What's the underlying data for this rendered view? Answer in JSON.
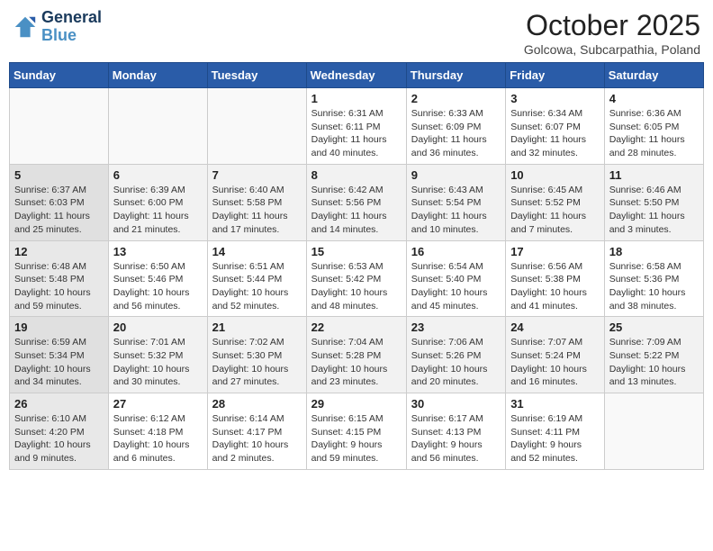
{
  "logo": {
    "line1": "General",
    "line2": "Blue"
  },
  "title": "October 2025",
  "subtitle": "Golcowa, Subcarpathia, Poland",
  "days_header": [
    "Sunday",
    "Monday",
    "Tuesday",
    "Wednesday",
    "Thursday",
    "Friday",
    "Saturday"
  ],
  "weeks": [
    [
      {
        "num": "",
        "info": ""
      },
      {
        "num": "",
        "info": ""
      },
      {
        "num": "",
        "info": ""
      },
      {
        "num": "1",
        "info": "Sunrise: 6:31 AM\nSunset: 6:11 PM\nDaylight: 11 hours\nand 40 minutes."
      },
      {
        "num": "2",
        "info": "Sunrise: 6:33 AM\nSunset: 6:09 PM\nDaylight: 11 hours\nand 36 minutes."
      },
      {
        "num": "3",
        "info": "Sunrise: 6:34 AM\nSunset: 6:07 PM\nDaylight: 11 hours\nand 32 minutes."
      },
      {
        "num": "4",
        "info": "Sunrise: 6:36 AM\nSunset: 6:05 PM\nDaylight: 11 hours\nand 28 minutes."
      }
    ],
    [
      {
        "num": "5",
        "info": "Sunrise: 6:37 AM\nSunset: 6:03 PM\nDaylight: 11 hours\nand 25 minutes."
      },
      {
        "num": "6",
        "info": "Sunrise: 6:39 AM\nSunset: 6:00 PM\nDaylight: 11 hours\nand 21 minutes."
      },
      {
        "num": "7",
        "info": "Sunrise: 6:40 AM\nSunset: 5:58 PM\nDaylight: 11 hours\nand 17 minutes."
      },
      {
        "num": "8",
        "info": "Sunrise: 6:42 AM\nSunset: 5:56 PM\nDaylight: 11 hours\nand 14 minutes."
      },
      {
        "num": "9",
        "info": "Sunrise: 6:43 AM\nSunset: 5:54 PM\nDaylight: 11 hours\nand 10 minutes."
      },
      {
        "num": "10",
        "info": "Sunrise: 6:45 AM\nSunset: 5:52 PM\nDaylight: 11 hours\nand 7 minutes."
      },
      {
        "num": "11",
        "info": "Sunrise: 6:46 AM\nSunset: 5:50 PM\nDaylight: 11 hours\nand 3 minutes."
      }
    ],
    [
      {
        "num": "12",
        "info": "Sunrise: 6:48 AM\nSunset: 5:48 PM\nDaylight: 10 hours\nand 59 minutes."
      },
      {
        "num": "13",
        "info": "Sunrise: 6:50 AM\nSunset: 5:46 PM\nDaylight: 10 hours\nand 56 minutes."
      },
      {
        "num": "14",
        "info": "Sunrise: 6:51 AM\nSunset: 5:44 PM\nDaylight: 10 hours\nand 52 minutes."
      },
      {
        "num": "15",
        "info": "Sunrise: 6:53 AM\nSunset: 5:42 PM\nDaylight: 10 hours\nand 48 minutes."
      },
      {
        "num": "16",
        "info": "Sunrise: 6:54 AM\nSunset: 5:40 PM\nDaylight: 10 hours\nand 45 minutes."
      },
      {
        "num": "17",
        "info": "Sunrise: 6:56 AM\nSunset: 5:38 PM\nDaylight: 10 hours\nand 41 minutes."
      },
      {
        "num": "18",
        "info": "Sunrise: 6:58 AM\nSunset: 5:36 PM\nDaylight: 10 hours\nand 38 minutes."
      }
    ],
    [
      {
        "num": "19",
        "info": "Sunrise: 6:59 AM\nSunset: 5:34 PM\nDaylight: 10 hours\nand 34 minutes."
      },
      {
        "num": "20",
        "info": "Sunrise: 7:01 AM\nSunset: 5:32 PM\nDaylight: 10 hours\nand 30 minutes."
      },
      {
        "num": "21",
        "info": "Sunrise: 7:02 AM\nSunset: 5:30 PM\nDaylight: 10 hours\nand 27 minutes."
      },
      {
        "num": "22",
        "info": "Sunrise: 7:04 AM\nSunset: 5:28 PM\nDaylight: 10 hours\nand 23 minutes."
      },
      {
        "num": "23",
        "info": "Sunrise: 7:06 AM\nSunset: 5:26 PM\nDaylight: 10 hours\nand 20 minutes."
      },
      {
        "num": "24",
        "info": "Sunrise: 7:07 AM\nSunset: 5:24 PM\nDaylight: 10 hours\nand 16 minutes."
      },
      {
        "num": "25",
        "info": "Sunrise: 7:09 AM\nSunset: 5:22 PM\nDaylight: 10 hours\nand 13 minutes."
      }
    ],
    [
      {
        "num": "26",
        "info": "Sunrise: 6:10 AM\nSunset: 4:20 PM\nDaylight: 10 hours\nand 9 minutes."
      },
      {
        "num": "27",
        "info": "Sunrise: 6:12 AM\nSunset: 4:18 PM\nDaylight: 10 hours\nand 6 minutes."
      },
      {
        "num": "28",
        "info": "Sunrise: 6:14 AM\nSunset: 4:17 PM\nDaylight: 10 hours\nand 2 minutes."
      },
      {
        "num": "29",
        "info": "Sunrise: 6:15 AM\nSunset: 4:15 PM\nDaylight: 9 hours\nand 59 minutes."
      },
      {
        "num": "30",
        "info": "Sunrise: 6:17 AM\nSunset: 4:13 PM\nDaylight: 9 hours\nand 56 minutes."
      },
      {
        "num": "31",
        "info": "Sunrise: 6:19 AM\nSunset: 4:11 PM\nDaylight: 9 hours\nand 52 minutes."
      },
      {
        "num": "",
        "info": ""
      }
    ]
  ]
}
